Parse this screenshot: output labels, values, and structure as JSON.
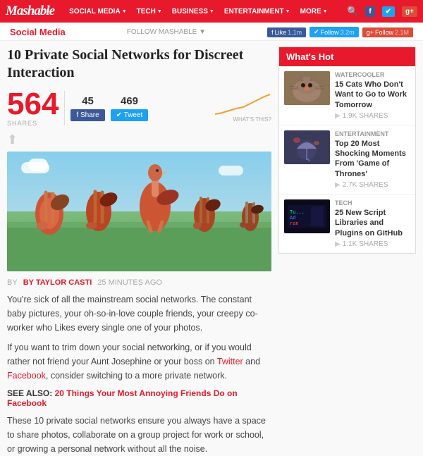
{
  "nav": {
    "logo": "Mashable",
    "items": [
      {
        "label": "Social Media",
        "has_caret": true
      },
      {
        "label": "Tech",
        "has_caret": true
      },
      {
        "label": "Business",
        "has_caret": true
      },
      {
        "label": "Entertainment",
        "has_caret": true
      },
      {
        "label": "More",
        "has_caret": true
      }
    ]
  },
  "breadcrumb": "Social Media",
  "follow": {
    "label": "Follow Mashable ▼",
    "facebook": {
      "label": "f Like",
      "count": "1.1m"
    },
    "twitter": {
      "label": "✔ Follow",
      "count": "3.2m"
    },
    "google": {
      "label": "g+ Follow",
      "count": "2.1M"
    }
  },
  "article": {
    "title": "10 Private Social Networks for Discreet Interaction",
    "shares_total": "564",
    "shares_label": "SHARES",
    "fb_count": "45",
    "tweet_count": "469",
    "fb_share_label": "f Share",
    "tweet_label": "✔ Tweet",
    "whats_this": "WHAT'S THIS?",
    "byline": "BY TAYLOR CASTI",
    "time_ago": "25 MINUTES AGO",
    "body1": "You're sick of all the mainstream social networks. The constant baby pictures, your oh-so-in-love couple friends, your creepy co-worker who Likes every single one of your photos.",
    "body2": "If you want to trim down your social networking, or if you would rather not friend your Aunt Josephine or your boss on Twitter and Facebook, consider switching to a more private network.",
    "see_also_prefix": "SEE ALSO:",
    "see_also_link": "20 Things Your Most Annoying Friends Do on Facebook",
    "body3": "These 10 private social networks ensure you always have a space to share photos, collaborate on a group project for work or school, or growing a personal network without all the noise."
  },
  "sidebar": {
    "header": "What's Hot",
    "items": [
      {
        "category": "WATERCOOLER",
        "title": "15 Cats Who Don't Want to Go to Work Tomorrow",
        "shares": "1.9K",
        "emoji": "🐱"
      },
      {
        "category": "ENTERTAINMENT",
        "title": "Top 20 Most Shocking Moments From 'Game of Thrones'",
        "shares": "2.7K",
        "emoji": "☂"
      },
      {
        "category": "TECH",
        "title": "25 New Script Libraries and Plugins on GitHub",
        "shares": "1.1K",
        "emoji": "💻"
      }
    ]
  }
}
